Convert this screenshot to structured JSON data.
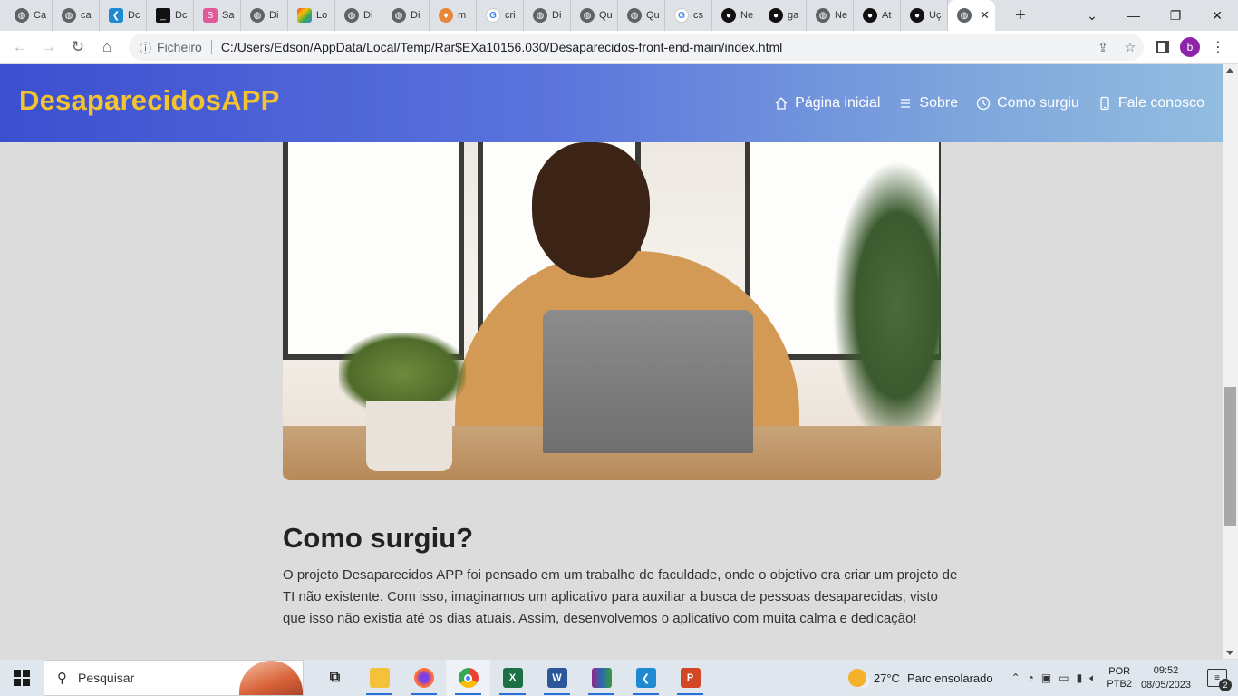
{
  "browser": {
    "tabs": [
      {
        "label": "Ca",
        "icon": "globe-icon"
      },
      {
        "label": "ca",
        "icon": "globe-icon"
      },
      {
        "label": "Dc",
        "icon": "vscode-icon"
      },
      {
        "label": "Dc",
        "icon": "terminal-icon"
      },
      {
        "label": "Sa",
        "icon": "pink-app-icon"
      },
      {
        "label": "Di",
        "icon": "globe-icon"
      },
      {
        "label": "Lo",
        "icon": "google-apps-icon"
      },
      {
        "label": "Di",
        "icon": "globe-icon"
      },
      {
        "label": "Di",
        "icon": "globe-icon"
      },
      {
        "label": "m",
        "icon": "shield-icon"
      },
      {
        "label": "cri",
        "icon": "google-icon"
      },
      {
        "label": "Di",
        "icon": "globe-icon"
      },
      {
        "label": "Qu",
        "icon": "globe-icon"
      },
      {
        "label": "Qu",
        "icon": "globe-icon"
      },
      {
        "label": "cs",
        "icon": "google-icon"
      },
      {
        "label": "Ne",
        "icon": "github-icon"
      },
      {
        "label": "ga",
        "icon": "github-icon"
      },
      {
        "label": "Ne",
        "icon": "globe-icon"
      },
      {
        "label": "At",
        "icon": "github-icon"
      },
      {
        "label": "Uç",
        "icon": "github-icon"
      }
    ],
    "active_tab_close": "✕",
    "new_tab": "+",
    "address": {
      "scheme_label": "Ficheiro",
      "url": "C:/Users/Edson/AppData/Local/Temp/Rar$EXa10156.030/Desaparecidos-front-end-main/index.html"
    },
    "profile_initial": "b"
  },
  "site": {
    "brand": "DesaparecidosAPP",
    "brand_color": "#f4c430",
    "nav": [
      {
        "label": "Página inicial",
        "icon": "home-icon"
      },
      {
        "label": "Sobre",
        "icon": "list-icon"
      },
      {
        "label": "Como surgiu",
        "icon": "clock-icon"
      },
      {
        "label": "Fale conosco",
        "icon": "phone-icon"
      }
    ],
    "section": {
      "title": "Como surgiu?",
      "text": "O projeto Desaparecidos APP foi pensado em um trabalho de faculdade, onde o objetivo era criar um projeto de TI não existente. Com isso, imaginamos um aplicativo para auxiliar a busca de pessoas desaparecidas, visto que isso não existia até os dias atuais. Assim, desenvolvemos o aplicativo com muita calma e dedicação!"
    }
  },
  "taskbar": {
    "search_placeholder": "Pesquisar",
    "apps": [
      "task-view",
      "file-explorer",
      "firefox",
      "chrome",
      "excel",
      "word",
      "winrar",
      "vscode",
      "powerpoint"
    ],
    "weather": {
      "temp": "27°C",
      "desc": "Parc ensolarado"
    },
    "lang": {
      "line1": "POR",
      "line2": "PTB2"
    },
    "clock": {
      "time": "09:52",
      "date": "08/05/2023"
    },
    "notifications": "2"
  }
}
